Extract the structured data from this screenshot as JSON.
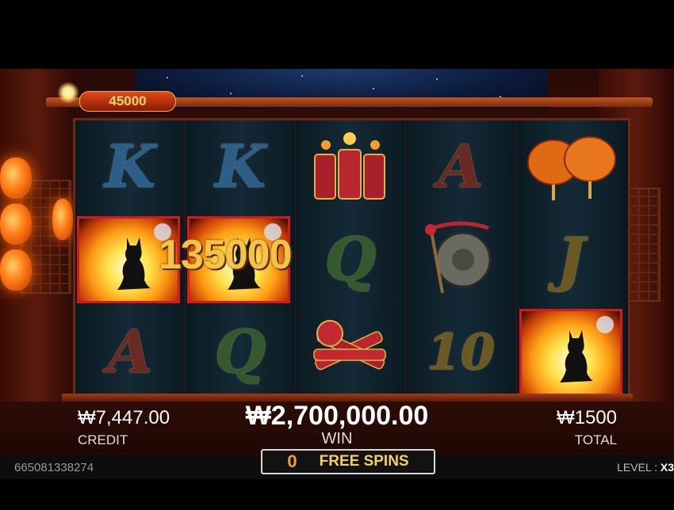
{
  "jackpot_value": "45000",
  "reels": [
    [
      {
        "symbol": "K",
        "style": "blue"
      },
      {
        "symbol": "wild",
        "label": "wild-cat"
      },
      {
        "symbol": "A",
        "style": "red"
      }
    ],
    [
      {
        "symbol": "K",
        "style": "blue"
      },
      {
        "symbol": "wild",
        "label": "wild-cat"
      },
      {
        "symbol": "Q",
        "style": "green"
      }
    ],
    [
      {
        "symbol": "firecrackers-icon"
      },
      {
        "symbol": "Q",
        "style": "green"
      },
      {
        "symbol": "firecracker-bundle-icon"
      }
    ],
    [
      {
        "symbol": "A",
        "style": "red"
      },
      {
        "symbol": "gong-icon"
      },
      {
        "symbol": "10",
        "style": "gold"
      }
    ],
    [
      {
        "symbol": "lanterns-icon"
      },
      {
        "symbol": "J",
        "style": "gold"
      },
      {
        "symbol": "wild",
        "label": "wild-cat"
      }
    ]
  ],
  "line_win_amount": "135000",
  "credit": {
    "value": "₩7,447.00",
    "label": "CREDIT"
  },
  "win": {
    "value": "₩2,700,000.00",
    "label": "WIN"
  },
  "total": {
    "value": "₩1500",
    "label": "TOTAL"
  },
  "free_spins": {
    "count": "0",
    "label": "FREE SPINS"
  },
  "round_id": "665081338274",
  "level": {
    "label": "LEVEL :",
    "value": "X3"
  },
  "colors": {
    "win_border": "#d61a1a",
    "accent_gold": "#f6c24a",
    "free_spins_count": "#f2a12a"
  }
}
